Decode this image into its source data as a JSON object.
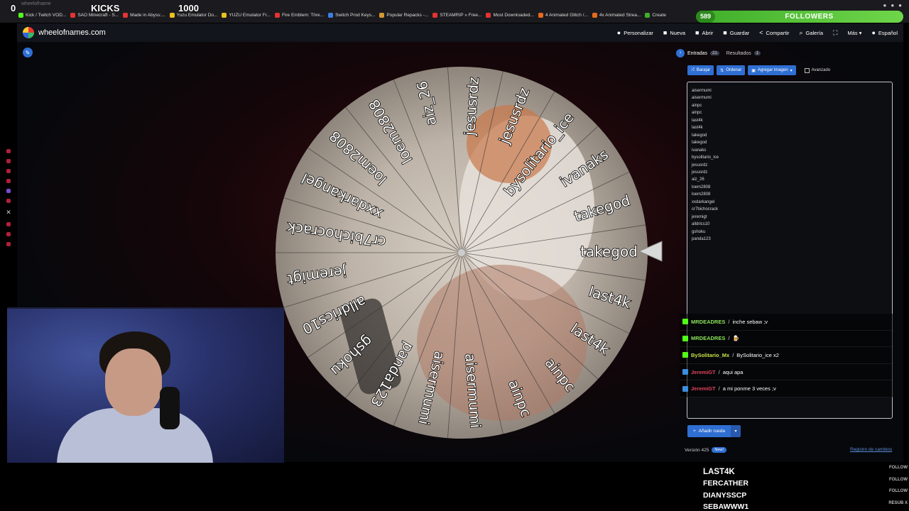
{
  "browser": {
    "url_snippet": "wheelofname",
    "bookmarks": [
      {
        "label": "Kick / Twitch VOD...",
        "color": "#53fc18"
      },
      {
        "label": "SAO Minecraft - S...",
        "color": "#e33333"
      },
      {
        "label": "Made in Abyss:...",
        "color": "#e33333"
      },
      {
        "label": "Yuzu Emulator Do...",
        "color": "#e8c21d"
      },
      {
        "label": "YUZU Emulator Fr...",
        "color": "#e8c21d"
      },
      {
        "label": "Fire Emblem: Thre...",
        "color": "#e33333"
      },
      {
        "label": "Switch Prod Keys...",
        "color": "#3d7ee6"
      },
      {
        "label": "Popular Repacks -...",
        "color": "#d39b2d"
      },
      {
        "label": "STEAMRIP » Free...",
        "color": "#e33333"
      },
      {
        "label": "Most Downloaded...",
        "color": "#e33333"
      },
      {
        "label": "4 Animated Glitch /...",
        "color": "#e36a1e"
      },
      {
        "label": "4x Animated Strea...",
        "color": "#e36a1e"
      },
      {
        "label": "Create",
        "color": "#3fae2a"
      }
    ],
    "ext_icons": [
      "pin-icon",
      "puzzle-icon",
      "profile-icon"
    ]
  },
  "overlay": {
    "left_count": "0",
    "kicks_label": "KICKS",
    "kicks_goal": "1000",
    "followers_count": "589",
    "followers_label": "FOLLOWERS"
  },
  "app": {
    "site_name": "wheelofnames.com",
    "menu": [
      {
        "icon": "palette-icon",
        "glyph": "●",
        "label": "Personalizar"
      },
      {
        "icon": "new-file-icon",
        "glyph": "■",
        "label": "Nueva"
      },
      {
        "icon": "folder-icon",
        "glyph": "■",
        "label": "Abrir"
      },
      {
        "icon": "save-icon",
        "glyph": "■",
        "label": "Guardar"
      },
      {
        "icon": "share-icon",
        "glyph": "<",
        "label": "Compartir"
      },
      {
        "icon": "search-icon",
        "glyph": "⌕",
        "label": "Galería"
      },
      {
        "icon": "fullscreen-icon",
        "glyph": "⛶",
        "label": ""
      },
      {
        "icon": "more-icon",
        "glyph": "",
        "label": "Más ▾"
      },
      {
        "icon": "globe-icon",
        "glyph": "●",
        "label": "Español"
      }
    ]
  },
  "wheel": {
    "slices": [
      "takegod",
      "last4k",
      "last4k",
      "ainpc",
      "ainpc",
      "aisermumi",
      "aisermumi",
      "panda123",
      "gshoku",
      "alldrics10",
      "jeremigt",
      "cr7bichocrack",
      "xxdarkangel",
      "loem2808",
      "loem2808",
      "aiz_26",
      "jesusrdz",
      "jesusrdz",
      "bysolitario_ice",
      "ivanaks",
      "takegod"
    ]
  },
  "panel": {
    "tab_entries": "Entradas",
    "tab_entries_count": "21",
    "tab_results": "Resultados",
    "tab_results_count": "1",
    "btn_shuffle": "Barajar",
    "btn_sort": "Ordenar",
    "btn_add_image": "Agregar imagen",
    "advanced": "Avanzado",
    "entries": [
      "aisermumi",
      "aisermumi",
      "ainpc",
      "ainpc",
      "last4k",
      "last4k",
      "takegod",
      "takegod",
      "ivanaks",
      "bysolitario_ice",
      "jesusrdz",
      "jesusrdz",
      "aiz_26",
      "loem2808",
      "loem2808",
      "xxdarkangel",
      "cr7bichocrack",
      "jeremigt",
      "alldrics10",
      "gshoku",
      "panda123"
    ],
    "add_wheel": "Añadir rueda",
    "version": "Versión 425",
    "new_badge": "New!",
    "changelog": "Registro de cambios"
  },
  "chat": [
    {
      "user": "MRDEADRES",
      "msg": "inche sebaw ;v",
      "user_color": "#8be35a",
      "badge_color": "#53fc18"
    },
    {
      "user": "MRDEADRES",
      "msg": "🍺",
      "user_color": "#8be35a",
      "badge_color": "#53fc18"
    },
    {
      "user": "BySolitario_Mx",
      "msg": "BySolitario_ice x2",
      "user_color": "#c6e04a",
      "badge_color": "#53fc18"
    },
    {
      "user": "JeremiGT",
      "msg": "aqui apa",
      "user_color": "#e0445c",
      "badge_color": "#3b8de0"
    },
    {
      "user": "JeremiGT",
      "msg": "a mi ponme 3 veces ;v",
      "user_color": "#e0445c",
      "badge_color": "#3b8de0"
    }
  ],
  "follow_list": [
    {
      "name": "LAST4K",
      "tag": "FOLLOW"
    },
    {
      "name": "FERCATHER",
      "tag": "FOLLOW"
    },
    {
      "name": "DIANYSSCP",
      "tag": "FOLLOW"
    },
    {
      "name": "SEBAWWW1",
      "tag": "RESUB X"
    }
  ]
}
